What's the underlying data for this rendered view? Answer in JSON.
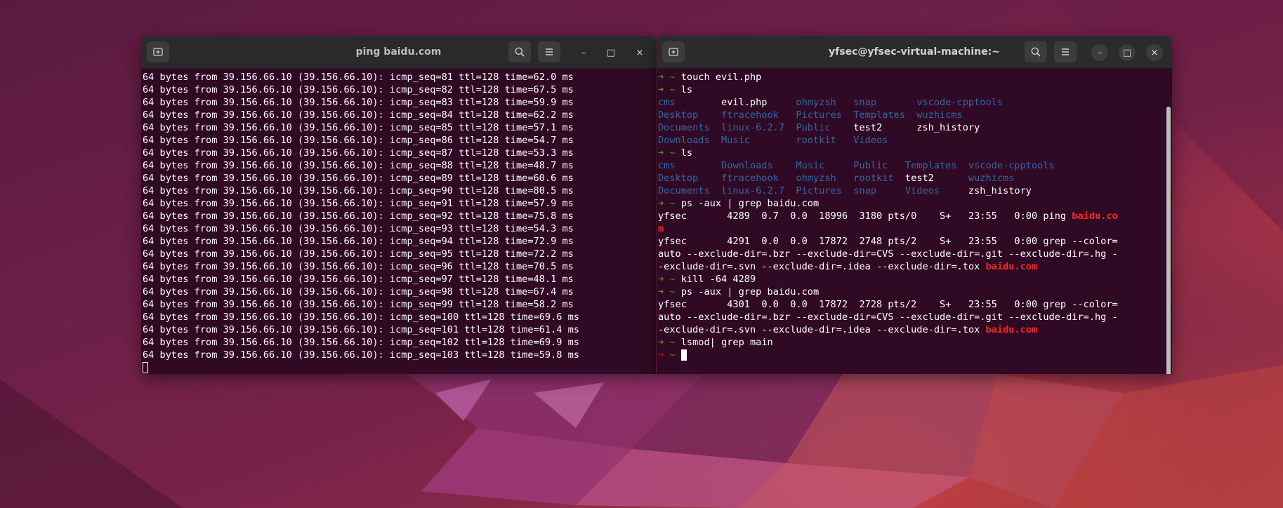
{
  "colors": {
    "terminal_bg": "#300a24",
    "directory": "#3465a4",
    "prompt_arrow": "#4e9a06",
    "prompt_arrow_error": "#cc0000",
    "grep_match": "#ef2929"
  },
  "left_window": {
    "title": "ping baidu.com",
    "buttons": {
      "new_tab_icon": "new-tab-icon",
      "search_icon": "search-icon",
      "menu_icon": "hamburger-menu-icon",
      "minimize": "–",
      "maximize": "□",
      "close": "×"
    },
    "lines": [
      "64 bytes from 39.156.66.10 (39.156.66.10): icmp_seq=81 ttl=128 time=62.0 ms",
      "64 bytes from 39.156.66.10 (39.156.66.10): icmp_seq=82 ttl=128 time=67.5 ms",
      "64 bytes from 39.156.66.10 (39.156.66.10): icmp_seq=83 ttl=128 time=59.9 ms",
      "64 bytes from 39.156.66.10 (39.156.66.10): icmp_seq=84 ttl=128 time=62.2 ms",
      "64 bytes from 39.156.66.10 (39.156.66.10): icmp_seq=85 ttl=128 time=57.1 ms",
      "64 bytes from 39.156.66.10 (39.156.66.10): icmp_seq=86 ttl=128 time=54.7 ms",
      "64 bytes from 39.156.66.10 (39.156.66.10): icmp_seq=87 ttl=128 time=53.3 ms",
      "64 bytes from 39.156.66.10 (39.156.66.10): icmp_seq=88 ttl=128 time=48.7 ms",
      "64 bytes from 39.156.66.10 (39.156.66.10): icmp_seq=89 ttl=128 time=60.6 ms",
      "64 bytes from 39.156.66.10 (39.156.66.10): icmp_seq=90 ttl=128 time=80.5 ms",
      "64 bytes from 39.156.66.10 (39.156.66.10): icmp_seq=91 ttl=128 time=57.9 ms",
      "64 bytes from 39.156.66.10 (39.156.66.10): icmp_seq=92 ttl=128 time=75.8 ms",
      "64 bytes from 39.156.66.10 (39.156.66.10): icmp_seq=93 ttl=128 time=54.3 ms",
      "64 bytes from 39.156.66.10 (39.156.66.10): icmp_seq=94 ttl=128 time=72.9 ms",
      "64 bytes from 39.156.66.10 (39.156.66.10): icmp_seq=95 ttl=128 time=72.2 ms",
      "64 bytes from 39.156.66.10 (39.156.66.10): icmp_seq=96 ttl=128 time=70.5 ms",
      "64 bytes from 39.156.66.10 (39.156.66.10): icmp_seq=97 ttl=128 time=48.1 ms",
      "64 bytes from 39.156.66.10 (39.156.66.10): icmp_seq=98 ttl=128 time=67.4 ms",
      "64 bytes from 39.156.66.10 (39.156.66.10): icmp_seq=99 ttl=128 time=58.2 ms",
      "64 bytes from 39.156.66.10 (39.156.66.10): icmp_seq=100 ttl=128 time=69.6 ms",
      "64 bytes from 39.156.66.10 (39.156.66.10): icmp_seq=101 ttl=128 time=61.4 ms",
      "64 bytes from 39.156.66.10 (39.156.66.10): icmp_seq=102 ttl=128 time=69.9 ms",
      "64 bytes from 39.156.66.10 (39.156.66.10): icmp_seq=103 ttl=128 time=59.8 ms"
    ]
  },
  "right_window": {
    "title": "yfsec@yfsec-virtual-machine:~",
    "buttons": {
      "new_tab_icon": "new-tab-icon",
      "search_icon": "search-icon",
      "menu_icon": "hamburger-menu-icon",
      "minimize": "–",
      "maximize": "□",
      "close": "×"
    },
    "prompt_arrow": "➜",
    "prompt_dir": "~",
    "cmd_touch": "touch evil.php",
    "cmd_ls": "ls",
    "ls1": [
      [
        "cms",
        "evil.php",
        "ohmyzsh",
        "snap",
        "vscode-cpptools"
      ],
      [
        "Desktop",
        "ftracehook",
        "Pictures",
        "Templates",
        "wuzhicms"
      ],
      [
        "Documents",
        "linux-6.2.7",
        "Public",
        "test2",
        "zsh_history"
      ],
      [
        "Downloads",
        "Music",
        "rootkit",
        "Videos",
        ""
      ]
    ],
    "ls2": [
      [
        "cms",
        "Downloads",
        "Music",
        "Public",
        "Templates",
        "vscode-cpptools"
      ],
      [
        "Desktop",
        "ftracehook",
        "ohmyzsh",
        "rootkit",
        "test2",
        "wuzhicms"
      ],
      [
        "Documents",
        "linux-6.2.7",
        "Pictures",
        "snap",
        "Videos",
        "zsh_history"
      ]
    ],
    "cmd_ps": "ps -aux | grep baidu.com",
    "ps1_row1_prefix": "yfsec       4289  0.7  0.0  18996  3180 pts/0    S+   23:55   0:00 ping ",
    "ps1_row1_match_a": "baidu.co",
    "ps1_row1_match_b": "m",
    "ps1_row2_line1": "yfsec       4291  0.0  0.0  17872  2748 pts/2    S+   23:55   0:00 grep --color=",
    "ps1_row2_line2": "auto --exclude-dir=.bzr --exclude-dir=CVS --exclude-dir=.git --exclude-dir=.hg -",
    "ps1_row2_line3": "-exclude-dir=.svn --exclude-dir=.idea --exclude-dir=.tox ",
    "match": "baidu.com",
    "cmd_kill": "kill -64 4289",
    "ps2_row_line1": "yfsec       4301  0.0  0.0  17872  2728 pts/2    S+   23:55   0:00 grep --color=",
    "ps2_row_line2": "auto --exclude-dir=.bzr --exclude-dir=CVS --exclude-dir=.git --exclude-dir=.hg -",
    "ps2_row_line3": "-exclude-dir=.svn --exclude-dir=.idea --exclude-dir=.tox ",
    "cmd_lsmod": "lsmod| grep main"
  }
}
